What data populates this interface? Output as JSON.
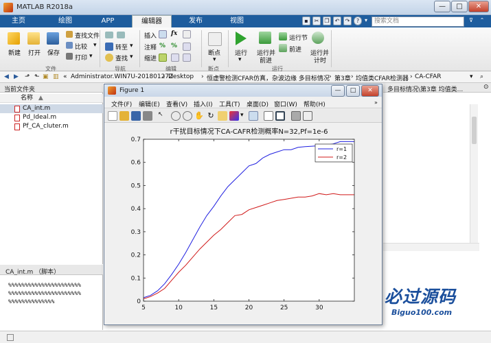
{
  "app": {
    "title": "MATLAB R2018a"
  },
  "window_controls": {
    "minimize": "—",
    "maximize": "□",
    "close": "✕"
  },
  "ribbon_tabs": [
    "主页",
    "绘图",
    "APP",
    "编辑器",
    "发布",
    "视图"
  ],
  "search": {
    "placeholder": "搜索文档"
  },
  "ribbon": {
    "file": {
      "new": "新建",
      "open": "打开",
      "save": "保存",
      "find_files": "查找文件",
      "compare": "比较",
      "print": "打印",
      "group": "文件"
    },
    "nav": {
      "goto": "转至",
      "find": "查找",
      "group": "导航"
    },
    "edit": {
      "insert": "插入",
      "comment": "注释",
      "indent": "缩进",
      "group": "编辑"
    },
    "breakpoints": {
      "label": "断点",
      "group": "断点"
    },
    "run": {
      "run": "运行",
      "run_advance_l1": "运行并",
      "run_advance_l2": "前进",
      "run_section": "运行节",
      "advance": "前进",
      "run_time_l1": "运行并",
      "run_time_l2": "计时",
      "group": "运行"
    }
  },
  "path": [
    "«",
    "Administrator.WIN7U-20180127Z",
    "Desktop",
    "恒虚警检测CFAR仿真，杂波边缘 多目标情况",
    "第3章",
    "均值类CFAR检测器",
    "CA-CFAR"
  ],
  "file_browser": {
    "title": "当前文件夹",
    "column": "名称",
    "sort_indicator": "▲",
    "files": [
      "CA_int.m",
      "Pd_Ideal.m",
      "Pf_CA_cluter.m"
    ]
  },
  "details": {
    "title": "CA_int.m （脚本）",
    "lines": [
      "%%%%%%%%%%%%%%%%%%%%%%",
      "%%%%%%%%%%%%%%%%%%%%%%",
      "%%%%%%%%%%%%%%"
    ]
  },
  "editor_peek": {
    "text": "多目标情况\\第3章  均值类..."
  },
  "figure": {
    "title": "Figure 1",
    "menus": [
      "文件(F)",
      "编辑(E)",
      "查看(V)",
      "插入(I)",
      "工具(T)",
      "桌面(D)",
      "窗口(W)",
      "帮助(H)"
    ]
  },
  "watermark": {
    "main": "必过源码",
    "sub": "Biguo100.com"
  },
  "chart_data": {
    "type": "line",
    "title": "r干扰目标情况下CA-CAFR检测概率N=32,Pf=1e-6",
    "xlabel": "",
    "ylabel": "",
    "xlim": [
      5,
      35
    ],
    "ylim": [
      0,
      0.7
    ],
    "xticks": [
      5,
      10,
      15,
      20,
      25,
      30
    ],
    "yticks": [
      0,
      0.1,
      0.2,
      0.3,
      0.4,
      0.5,
      0.6,
      0.7
    ],
    "legend_position": "top-right",
    "grid": false,
    "x": [
      5,
      6,
      7,
      8,
      9,
      10,
      11,
      12,
      13,
      14,
      15,
      16,
      17,
      18,
      19,
      20,
      21,
      22,
      23,
      24,
      25,
      26,
      27,
      28,
      29,
      30,
      31,
      32,
      33,
      34,
      35
    ],
    "series": [
      {
        "name": "r=1",
        "color": "#1f1fe0",
        "values": [
          0.015,
          0.025,
          0.045,
          0.075,
          0.115,
          0.16,
          0.21,
          0.265,
          0.32,
          0.37,
          0.41,
          0.455,
          0.495,
          0.525,
          0.555,
          0.585,
          0.595,
          0.62,
          0.635,
          0.645,
          0.655,
          0.655,
          0.665,
          0.668,
          0.67,
          0.672,
          0.675,
          0.68,
          0.69,
          0.69,
          0.69
        ]
      },
      {
        "name": "r=2",
        "color": "#d01818",
        "values": [
          0.01,
          0.02,
          0.035,
          0.055,
          0.09,
          0.125,
          0.155,
          0.19,
          0.225,
          0.255,
          0.285,
          0.31,
          0.34,
          0.37,
          0.375,
          0.395,
          0.405,
          0.415,
          0.425,
          0.435,
          0.44,
          0.445,
          0.45,
          0.45,
          0.455,
          0.465,
          0.46,
          0.465,
          0.46,
          0.46,
          0.46
        ]
      }
    ]
  }
}
